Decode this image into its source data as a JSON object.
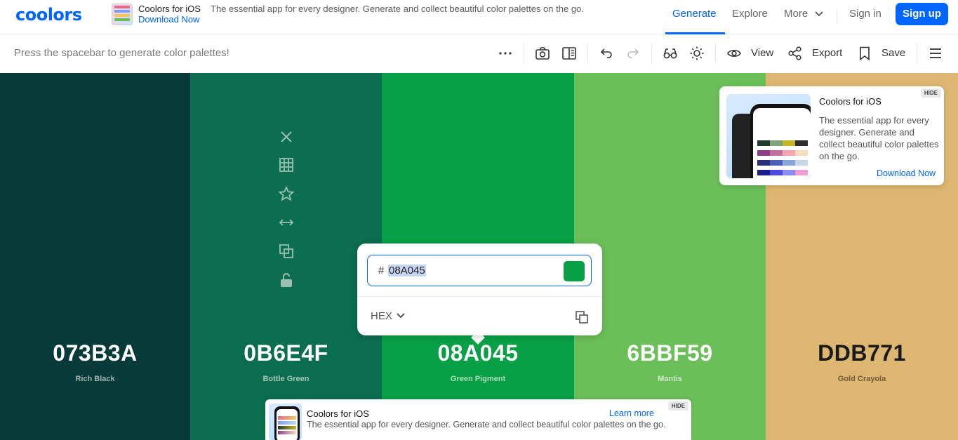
{
  "nav": {
    "logo": "coolors",
    "ad_title": "Coolors for iOS",
    "ad_desc": "The essential app for every designer. Generate and collect beautiful color palettes on the go.",
    "ad_link": "Download Now",
    "generate": "Generate",
    "explore": "Explore",
    "more": "More",
    "sign_in": "Sign in",
    "sign_up": "Sign up",
    "accent": "#0066ff"
  },
  "toolbar": {
    "hint": "Press the spacebar to generate color palettes!",
    "view": "View",
    "export": "Export",
    "save": "Save",
    "icons": [
      "more-icon",
      "camera-icon",
      "layout-icon",
      "undo-icon",
      "redo-icon",
      "glasses-icon",
      "sun-icon",
      "eye-icon",
      "share-icon",
      "bookmark-icon",
      "menu-icon"
    ]
  },
  "palette": [
    {
      "hex": "073B3A",
      "name": "Rich Black",
      "color": "#073B3A",
      "text_color": "#ffffff",
      "name_color": "#9fb3b2"
    },
    {
      "hex": "0B6E4F",
      "name": "Bottle Green",
      "color": "#0B6E4F",
      "text_color": "#ffffff",
      "name_color": "#a7c7bc"
    },
    {
      "hex": "08A045",
      "name": "Green Pigment",
      "color": "#08A045",
      "text_color": "#ffffff",
      "name_color": "#a9dcbd"
    },
    {
      "hex": "6BBF59",
      "name": "Mantis",
      "color": "#6BBF59",
      "text_color": "#ffffff",
      "name_color": "#cfe9c8"
    },
    {
      "hex": "DDB771",
      "name": "Gold Crayola",
      "color": "#DDB771",
      "text_color": "#1a1a1a",
      "name_color": "#6e5a36"
    }
  ],
  "column_tools": [
    "close-icon",
    "grid-icon",
    "star-icon",
    "arrows-horizontal-icon",
    "copy-icon",
    "unlock-icon"
  ],
  "picker": {
    "hash": "#",
    "value": "08A045",
    "mode": "HEX",
    "chip_color": "#08A045"
  },
  "ad_card": {
    "hide": "HIDE",
    "title": "Coolors for iOS",
    "desc": "The essential app for every designer. Generate and collect beautiful color palettes on the go.",
    "link": "Download Now"
  },
  "banner": {
    "hide": "HIDE",
    "title": "Coolors for iOS",
    "desc": "The essential app for every designer. Generate and collect beautiful color palettes on the go.",
    "link": "Learn more"
  }
}
